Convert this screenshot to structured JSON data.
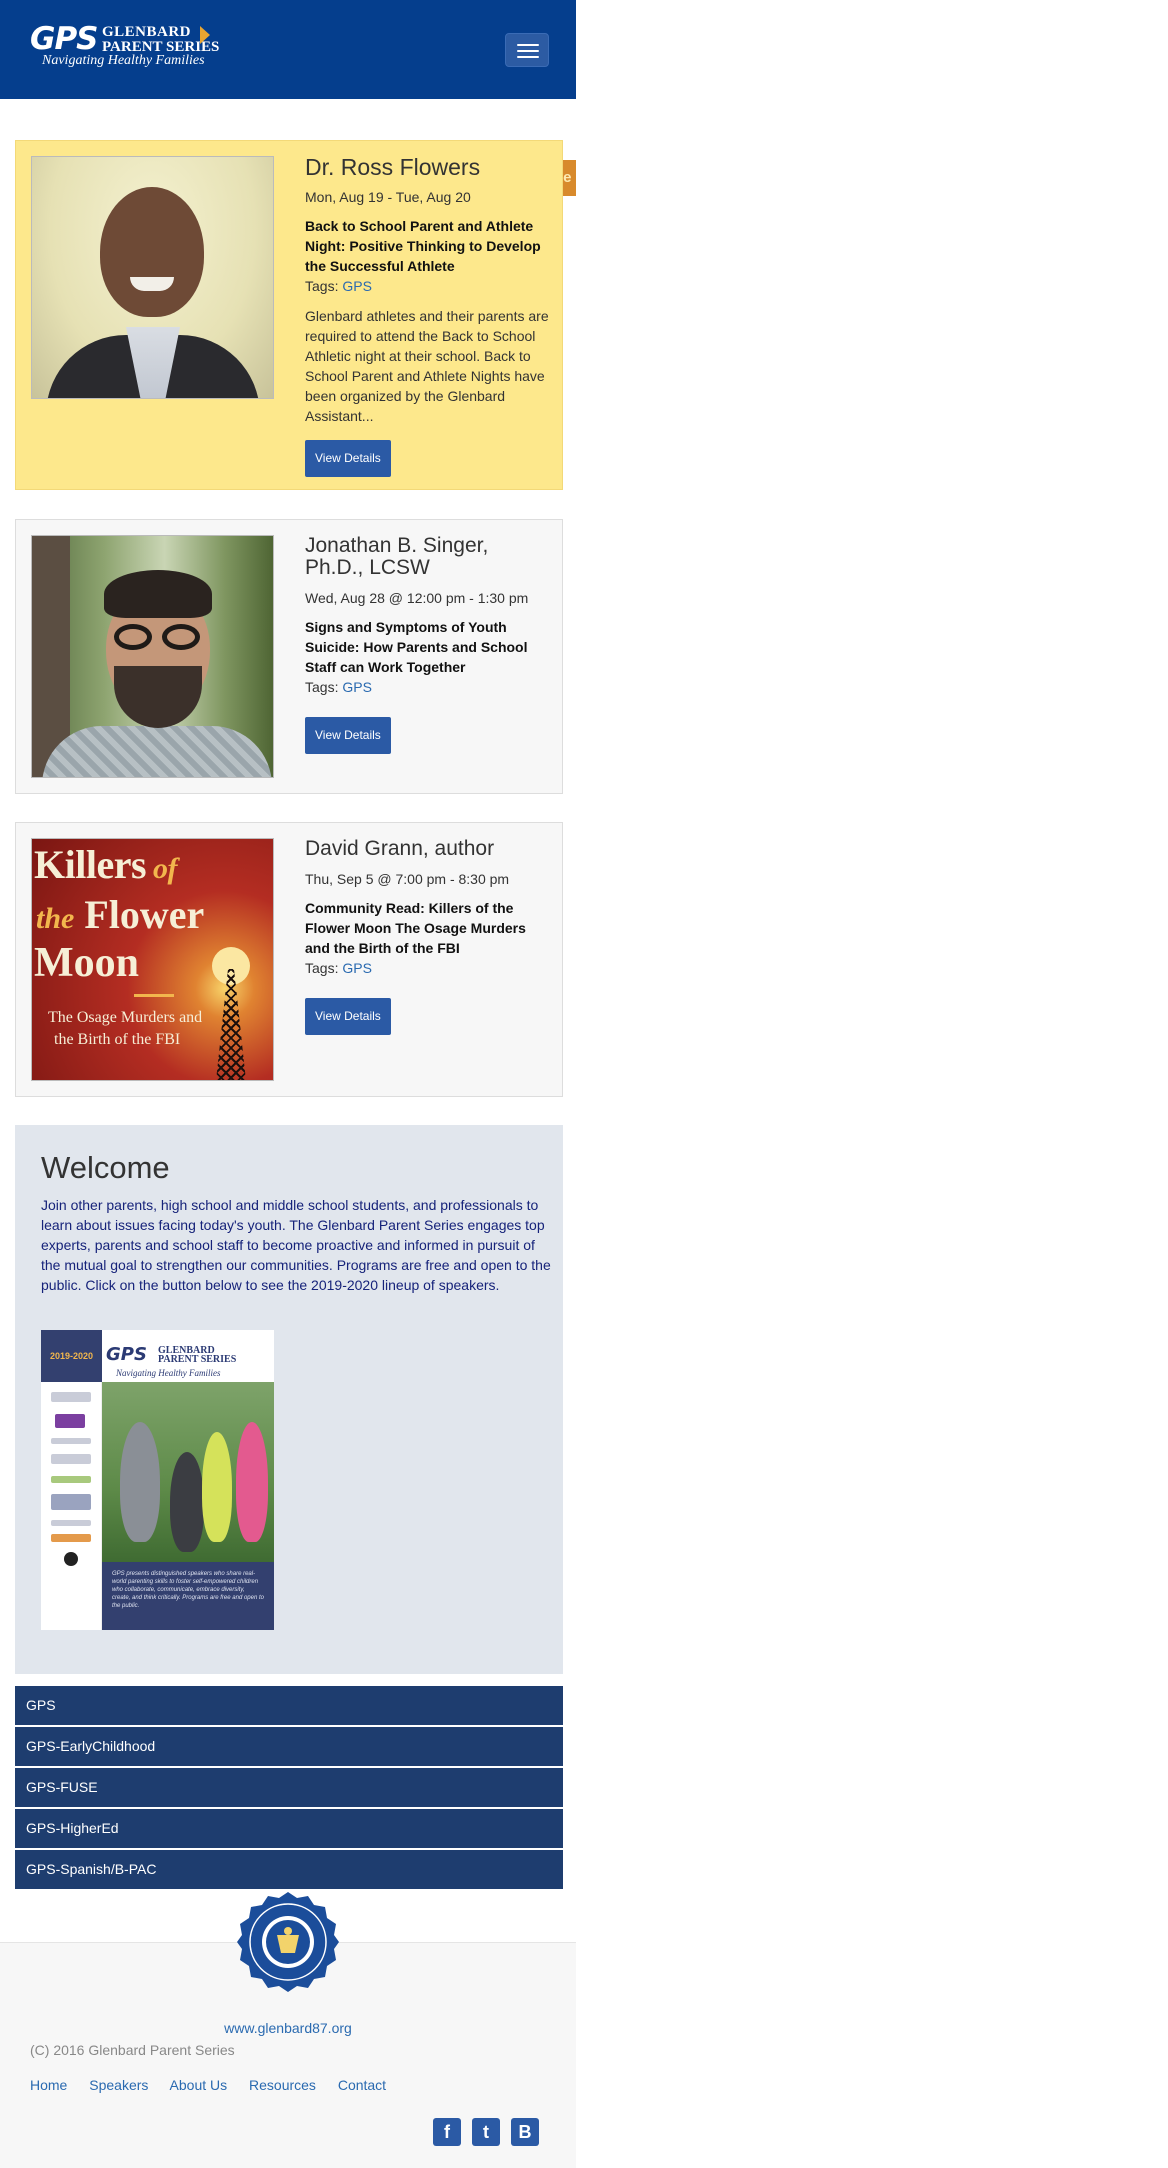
{
  "header": {
    "logo_gps": "GPS",
    "logo_line1": "GLENBARD",
    "logo_line2": "PARENT SERIES",
    "logo_tagline": "Navigating Healthy Families"
  },
  "donate_label": "Donate",
  "events": [
    {
      "speaker": "Dr. Ross Flowers",
      "date": "Mon, Aug 19 - Tue, Aug 20",
      "title": "Back to School Parent and Athlete Night: Positive Thinking to Develop the Successful Athlete",
      "tags_label": "Tags:",
      "tag": "GPS",
      "excerpt": "Glenbard athletes and their parents are required to attend the Back to School Athletic night at their school. Back to School Parent and Athlete Nights have been organized by the Glenbard Assistant...",
      "button": "View Details"
    },
    {
      "speaker": "Jonathan B. Singer, Ph.D., LCSW",
      "date": "Wed, Aug 28 @ 12:00 pm - 1:30 pm",
      "title": "Signs and Symptoms of Youth Suicide: How Parents and School Staff can Work Together",
      "tags_label": "Tags:",
      "tag": "GPS",
      "button": "View Details"
    },
    {
      "speaker": "David Grann, author",
      "date": "Thu, Sep 5 @ 7:00 pm - 8:30 pm",
      "title": "Community Read: Killers of the Flower Moon The Osage Murders and the Birth of the FBI",
      "tags_label": "Tags:",
      "tag": "GPS",
      "button": "View Details",
      "book_cover": {
        "line1_a": "Killers",
        "line1_b": " of",
        "line2_a": "the",
        "line2_b": " Flower",
        "line3": "Moon",
        "sub1": "The Osage Murders and",
        "sub2": "the Birth of the FBI"
      }
    }
  ],
  "welcome": {
    "heading": "Welcome",
    "body": "Join other parents, high school and middle school students, and professionals to learn about issues facing today's youth. The Glenbard Parent Series engages top experts, parents and school staff to become proactive and informed in pursuit of the mutual goal to strengthen our communities. Programs are free and open to the public. Click on the button below to see the 2019-2020 lineup of speakers.",
    "poster": {
      "year": "2019-2020",
      "gps": "GPS",
      "name1": "GLENBARD",
      "name2": "PARENT SERIES",
      "tagline": "Navigating Healthy Families",
      "caption": "GPS presents distinguished speakers who share real-world parenting skills to foster self-empowered children who collaborate, communicate, embrace diversity, create, and think critically. Programs are free and open to the public."
    }
  },
  "tag_list": [
    "GPS",
    "GPS-EarlyChildhood",
    "GPS-FUSE",
    "GPS-HigherEd",
    "GPS-Spanish/B-PAC"
  ],
  "footer": {
    "site": "www.glenbard87.org",
    "copyright": "(C) 2016 Glenbard Parent Series",
    "nav": [
      "Home",
      "Speakers",
      "About Us",
      "Resources",
      "Contact"
    ],
    "social": [
      {
        "icon": "facebook-icon",
        "glyph": "f"
      },
      {
        "icon": "twitter-icon",
        "glyph": "t"
      },
      {
        "icon": "blogger-icon",
        "glyph": "B"
      }
    ]
  },
  "colors": {
    "header_bg": "#053e8d",
    "featured_bg": "#fde88c",
    "button": "#2b5aa5",
    "taglist_bg": "#1e3d6f",
    "donate": "#d88a2c"
  }
}
